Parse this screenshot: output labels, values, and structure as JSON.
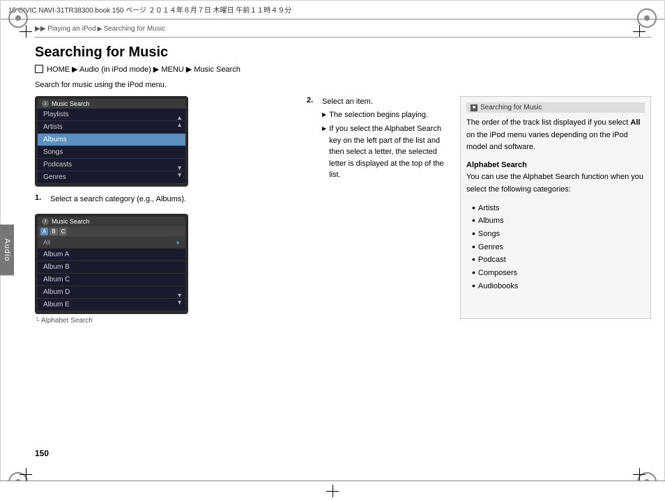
{
  "top_bar": {
    "text": "15 CIVIC NAVI-31TR38300.book   150 ページ   ２０１４年８月７日   木曜日   午前１１時４９分"
  },
  "breadcrumb": {
    "items": [
      "▶▶ Playing an iPod",
      "▶ Searching for Music"
    ]
  },
  "page": {
    "title": "Searching for Music",
    "nav_line": "HOME ▶ Audio (in iPod mode) ▶ MENU ▶ Music Search",
    "description": "Search for music using the iPod menu."
  },
  "screen1": {
    "header": "Music Search",
    "items": [
      "Playlists",
      "Artists",
      "Albums",
      "Songs",
      "Podcasts",
      "Genres"
    ]
  },
  "screen2": {
    "header": "Music Search",
    "alpha_buttons": [
      "A",
      "B",
      "C"
    ],
    "list_header": "All",
    "items": [
      "Album A",
      "Album B",
      "Album C",
      "Album D",
      "Album E"
    ],
    "caption": "Alphabet Search"
  },
  "steps": {
    "step1": {
      "number": "1.",
      "text": "Select a search category (e.g., Albums)."
    },
    "step2": {
      "number": "2.",
      "text": "Select an item.",
      "sub_items": [
        "The selection begins playing.",
        "If you select the Alphabet Search key on the left part of the list and then select a letter, the selected letter is displayed at the top of the list."
      ]
    }
  },
  "right_panel": {
    "title": "Searching for Music",
    "para1": "The order of the track list displayed if you select All on the iPod menu varies depending on the iPod model and software.",
    "alphabet_search_title": "Alphabet Search",
    "alphabet_search_desc": "You can use the Alphabet Search function when you select the following categories:",
    "categories": [
      "Artists",
      "Albums",
      "Songs",
      "Genres",
      "Podcast",
      "Composers",
      "Audiobooks"
    ]
  },
  "page_number": "150"
}
